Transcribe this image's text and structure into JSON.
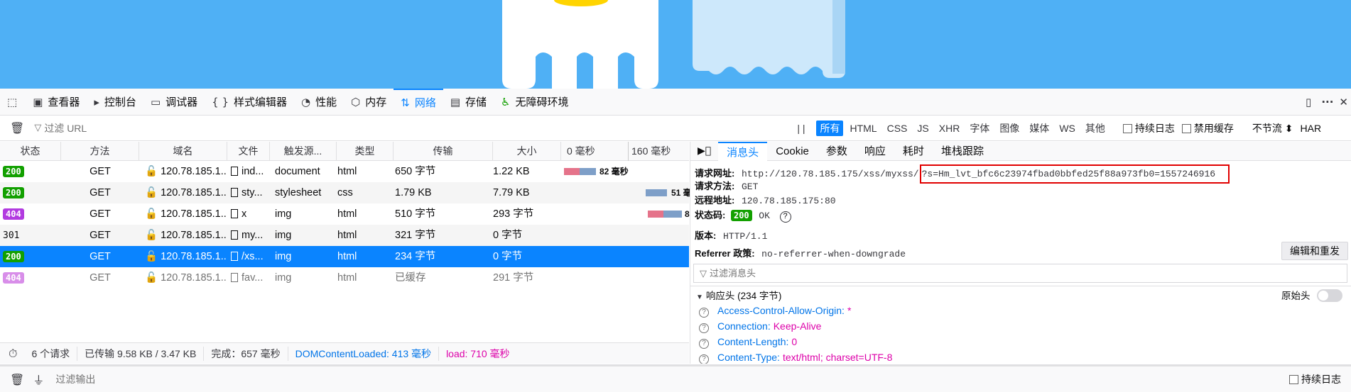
{
  "toolbar": {
    "tabs": [
      {
        "label": "查看器",
        "icon": "inspector-icon"
      },
      {
        "label": "控制台",
        "icon": "console-icon"
      },
      {
        "label": "调试器",
        "icon": "debugger-icon"
      },
      {
        "label": "样式编辑器",
        "icon": "style-editor-icon"
      },
      {
        "label": "性能",
        "icon": "performance-icon"
      },
      {
        "label": "内存",
        "icon": "memory-icon"
      },
      {
        "label": "网络",
        "icon": "network-icon",
        "selected": true
      },
      {
        "label": "存储",
        "icon": "storage-icon"
      },
      {
        "label": "无障碍环境",
        "icon": "accessibility-icon"
      }
    ]
  },
  "filterbar": {
    "url_placeholder": "过滤 URL",
    "pause": "| |",
    "types": [
      "所有",
      "HTML",
      "CSS",
      "JS",
      "XHR",
      "字体",
      "图像",
      "媒体",
      "WS",
      "其他"
    ],
    "persist_logs": "持续日志",
    "disable_cache": "禁用缓存",
    "throttle": "不节流 ⬍",
    "har": "HAR"
  },
  "table": {
    "headers": [
      "状态",
      "方法",
      "域名",
      "文件",
      "触发源...",
      "类型",
      "传输",
      "大小",
      "0 毫秒",
      "160 毫秒"
    ],
    "rows": [
      {
        "status": "200",
        "method": "GET",
        "domain": "120.78.185.1...",
        "file": "ind...",
        "cause": "document",
        "type": "html",
        "transferred": "650 字节",
        "size": "1.22 KB",
        "timing": "82 毫秒"
      },
      {
        "status": "200",
        "method": "GET",
        "domain": "120.78.185.1...",
        "file": "sty...",
        "cause": "stylesheet",
        "type": "css",
        "transferred": "1.79 KB",
        "size": "7.79 KB",
        "timing": "51 毫"
      },
      {
        "status": "404",
        "method": "GET",
        "domain": "120.78.185.1...",
        "file": "x",
        "cause": "img",
        "type": "html",
        "transferred": "510 字节",
        "size": "293 字节",
        "timing": ""
      },
      {
        "status": "301",
        "method": "GET",
        "domain": "120.78.185.1...",
        "file": "my...",
        "cause": "img",
        "type": "html",
        "transferred": "321 字节",
        "size": "0 字节",
        "timing": ""
      },
      {
        "status": "200",
        "method": "GET",
        "domain": "120.78.185.1...",
        "file": "/xs...",
        "cause": "img",
        "type": "html",
        "transferred": "234 字节",
        "size": "0 字节",
        "timing": ""
      },
      {
        "status": "404",
        "method": "GET",
        "domain": "120.78.185.1...",
        "file": "fav...",
        "cause": "img",
        "type": "html",
        "transferred": "已缓存",
        "size": "291 字节",
        "timing": ""
      }
    ]
  },
  "statusbar": {
    "requests": "6 个请求",
    "transferred": "已传输 9.58 KB / 3.47 KB",
    "finish": "完成：657 毫秒",
    "dcl": "DOMContentLoaded: 413 毫秒",
    "load": "load: 710 毫秒"
  },
  "detail": {
    "tabs": [
      "消息头",
      "Cookie",
      "参数",
      "响应",
      "耗时",
      "堆栈跟踪"
    ],
    "request_url_label": "请求网址:",
    "request_url_base": "http://120.78.185.175/xss/myxss/",
    "request_url_query": "?s=Hm_lvt_bfc6c23974fbad0bbfed25f88a973fb0=1557246916",
    "method_label": "请求方法:",
    "method": "GET",
    "remote_label": "远程地址:",
    "remote": "120.78.185.175:80",
    "status_label": "状态码:",
    "status_code": "200",
    "status_text": "OK",
    "version_label": "版本:",
    "version": "HTTP/1.1",
    "referrer_label": "Referrer 政策:",
    "referrer": "no-referrer-when-downgrade",
    "edit_resend": "编辑和重发",
    "filter_headers": "过滤消息头",
    "response_headers": "响应头 (234 字节)",
    "raw_headers": "原始头",
    "headers": [
      {
        "name": "Access-Control-Allow-Origin:",
        "value": "*"
      },
      {
        "name": "Connection:",
        "value": "Keep-Alive"
      },
      {
        "name": "Content-Length:",
        "value": "0"
      },
      {
        "name": "Content-Type:",
        "value": "text/html; charset=UTF-8"
      }
    ]
  },
  "console": {
    "filter_output": "过滤输出",
    "persist_logs": "持续日志"
  }
}
